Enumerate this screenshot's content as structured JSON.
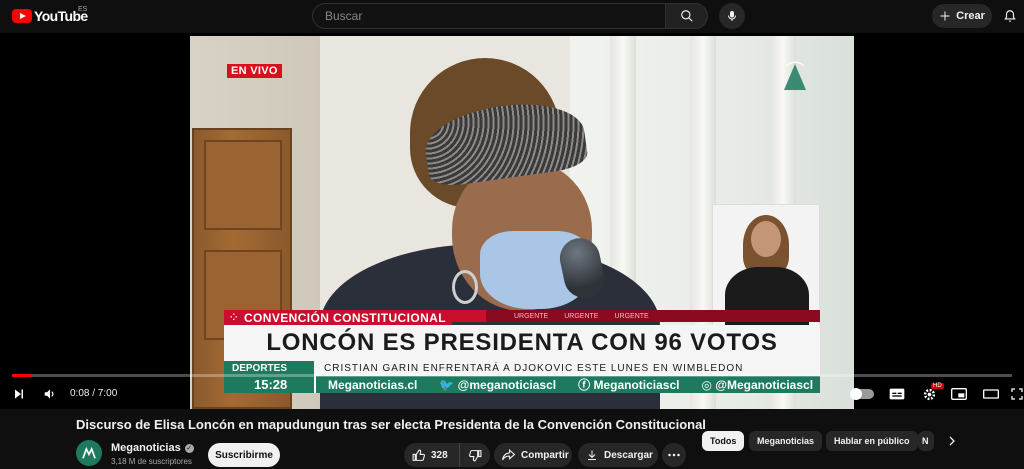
{
  "header": {
    "logo_text": "YouTube",
    "country_code": "ES",
    "search_placeholder": "Buscar",
    "create_label": "Crear"
  },
  "player": {
    "live_badge": "EN VIVO",
    "lower_third": {
      "section": "CONVENCIÓN CONSTITUCIONAL",
      "ticker_top": "URGENTE",
      "headline": "LONCÓN ES PRESIDENTA CON 96 VOTOS",
      "sub_label": "DEPORTES",
      "sub_text": "CRISTIAN GARIN ENFRENTARÁ A DJOKOVIC ESTE LUNES EN WIMBLEDON",
      "time": "15:28",
      "social_site": "Meganoticias.cl",
      "social_twitter": "@meganoticiascl",
      "social_facebook": "Meganoticiascl",
      "social_instagram": "@Meganoticiascl"
    },
    "time_display": "0:08 / 7:00",
    "progress": 0.019,
    "hd_badge": "HD"
  },
  "video": {
    "title": "Discurso de Elisa Loncón en mapudungun tras ser electa Presidenta de la Convención Constitucional",
    "channel_name": "Meganoticias",
    "subscribers": "3,18 M de suscriptores",
    "subscribe_label": "Suscribirme",
    "like_count": "328",
    "share_label": "Compartir",
    "download_label": "Descargar"
  },
  "chips": [
    "Todos",
    "Meganoticias",
    "Hablar en público",
    "N"
  ],
  "colors": {
    "brand_red": "#ff0000",
    "live_red": "#d7101b",
    "news_green": "#1d7a5f",
    "background": "#0f0f0f"
  }
}
